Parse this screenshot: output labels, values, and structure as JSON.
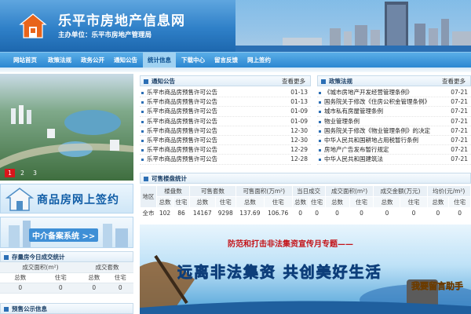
{
  "header": {
    "title": "乐平市房地产信息网",
    "sponsor": "主办单位：乐平市房地产管理局"
  },
  "nav": [
    "网站首页",
    "政策法规",
    "政务公开",
    "通知公告",
    "统计信息",
    "下载中心",
    "留言反馈",
    "网上签约"
  ],
  "nav_active_index": 4,
  "slideshow": {
    "pages": [
      "1",
      "2",
      "3"
    ],
    "current": "1"
  },
  "banners": {
    "signing": "商品房网上签约",
    "agency": "中介备案系统 >>",
    "main_subtitle": "防范和打击非法集资宣传月专题——",
    "main_title": "远离非法集资  共创美好生活",
    "main_tag": "我要留言助手"
  },
  "notices": {
    "title": "通知公告",
    "more": "查看更多",
    "items": [
      {
        "text": "乐平市商品房预售许可公告",
        "date": "01-13"
      },
      {
        "text": "乐平市商品房预售许可公告",
        "date": "01-13"
      },
      {
        "text": "乐平市商品房预售许可公告",
        "date": "01-09"
      },
      {
        "text": "乐平市商品房预售许可公告",
        "date": "01-09"
      },
      {
        "text": "乐平市商品房预售许可公告",
        "date": "12-30"
      },
      {
        "text": "乐平市商品房预售许可公告",
        "date": "12-30"
      },
      {
        "text": "乐平市商品房预售许可公告",
        "date": "12-29"
      },
      {
        "text": "乐平市商品房预售许可公告",
        "date": "12-28"
      }
    ]
  },
  "policies": {
    "title": "政策法规",
    "more": "查看更多",
    "items": [
      {
        "text": "《城市房地产开发经营管理条例》",
        "date": "07-21"
      },
      {
        "text": "国务院关于修改《住房公积金管理条例》",
        "date": "07-21"
      },
      {
        "text": "城市私有房屋管理条例",
        "date": "07-21"
      },
      {
        "text": "物业管理条例",
        "date": "07-21"
      },
      {
        "text": "国务院关于修改《物业管理条例》的决定",
        "date": "07-21"
      },
      {
        "text": "中华人民共和国耕地占用税暂行条例",
        "date": "07-21"
      },
      {
        "text": "房地产广告发布暂行规定",
        "date": "07-21"
      },
      {
        "text": "中华人民共和国建筑法",
        "date": "07-21"
      }
    ]
  },
  "sale_stats": {
    "title": "可售楼盘统计",
    "headers": [
      "地区",
      "楼盘数",
      "可售套数",
      "可售面积(万m²)",
      "当日成交",
      "成交面积(m²)",
      "成交金额(万元)",
      "均价(元/m²)"
    ],
    "subheaders": [
      "总数",
      "住宅",
      "总数",
      "住宅",
      "总数",
      "住宅",
      "总数",
      "住宅",
      "总数",
      "住宅",
      "总数",
      "住宅",
      "总数",
      "住宅"
    ],
    "row": [
      "全市",
      "102",
      "86",
      "14167",
      "9298",
      "137.69",
      "106.76",
      "0",
      "0",
      "0",
      "0",
      "0",
      "0",
      "0",
      "0"
    ]
  },
  "deal_stats": {
    "title": "存量房今日成交统计",
    "headers": [
      "成交面积(m²)",
      "成交套数"
    ],
    "subheaders": [
      "总数",
      "住宅",
      "总数",
      "住宅"
    ],
    "row": [
      "0",
      "0",
      "0",
      "0"
    ]
  },
  "presale": {
    "title": "预售公示信息"
  },
  "colors": {
    "header_blue": "#2f80c8",
    "nav_blue": "#2b87d1",
    "accent_red": "#d9161b",
    "link_blue": "#1b3f66"
  }
}
